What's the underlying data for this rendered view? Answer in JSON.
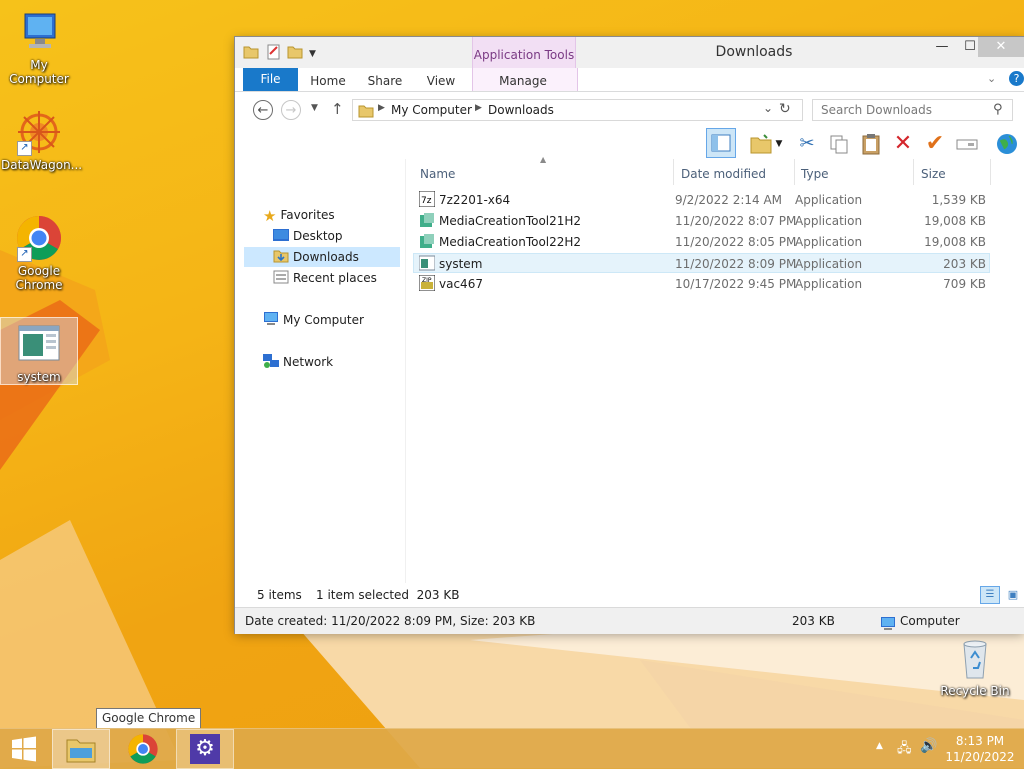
{
  "desktop": {
    "icons": [
      {
        "label": "My Computer"
      },
      {
        "label": "DataWagon..."
      },
      {
        "label": "Google Chrome"
      },
      {
        "label": "system"
      },
      {
        "label": "Recycle Bin"
      }
    ]
  },
  "window": {
    "title": "Downloads",
    "context_tab": "Application Tools",
    "ribbon_tabs": [
      "File",
      "Home",
      "Share",
      "View",
      "Manage"
    ],
    "address": {
      "segments": [
        "My Computer",
        "Downloads"
      ]
    },
    "search_placeholder": "Search Downloads",
    "nav": {
      "favorites": "Favorites",
      "favorites_items": [
        "Desktop",
        "Downloads",
        "Recent places"
      ],
      "computer": "My Computer",
      "network": "Network"
    },
    "columns": [
      "Name",
      "Date modified",
      "Type",
      "Size"
    ],
    "files": [
      {
        "name": "7z2201-x64",
        "date": "9/2/2022 2:14 AM",
        "type": "Application",
        "size": "1,539 KB"
      },
      {
        "name": "MediaCreationTool21H2",
        "date": "11/20/2022 8:07 PM",
        "type": "Application",
        "size": "19,008 KB"
      },
      {
        "name": "MediaCreationTool22H2",
        "date": "11/20/2022 8:05 PM",
        "type": "Application",
        "size": "19,008 KB"
      },
      {
        "name": "system",
        "date": "11/20/2022 8:09 PM",
        "type": "Application",
        "size": "203 KB"
      },
      {
        "name": "vac467",
        "date": "10/17/2022 9:45 PM",
        "type": "Application",
        "size": "709 KB"
      }
    ],
    "status": {
      "item_count": "5 items",
      "selection": "1 item selected  203 KB",
      "details": "Date created: 11/20/2022 8:09 PM, Size: 203 KB",
      "size": "203 KB",
      "location": "Computer"
    }
  },
  "taskbar": {
    "tooltip": "Google Chrome",
    "clock_time": "8:13 PM",
    "clock_date": "11/20/2022"
  },
  "colors": {
    "accent": "#1979ca",
    "context_tab": "#f2dff4",
    "selection": "#e5f3fb"
  }
}
